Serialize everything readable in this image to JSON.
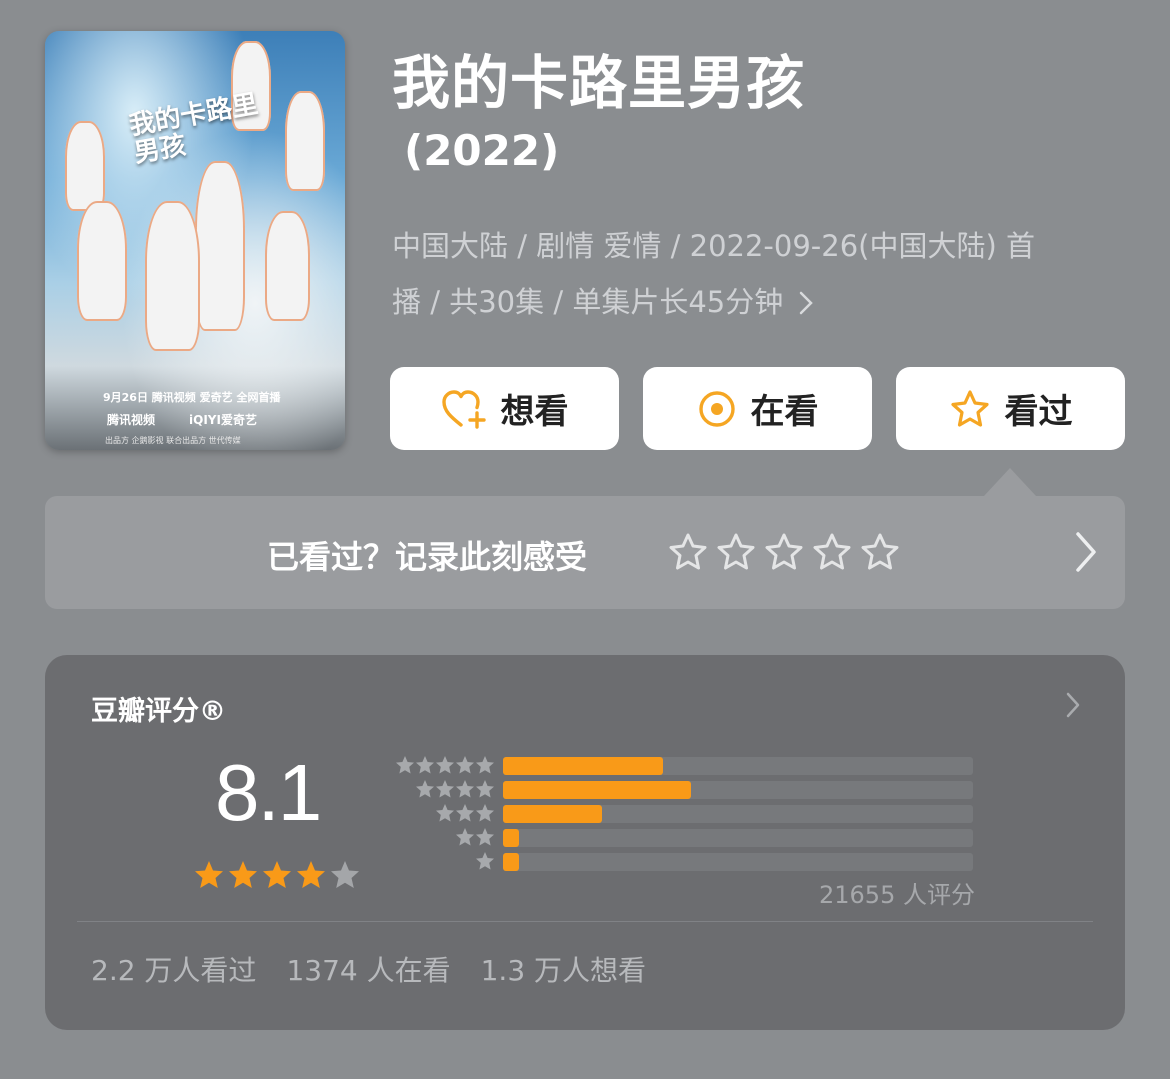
{
  "poster": {
    "title_art": "我的卡路里男孩",
    "release_line": "9月26日 腾讯视频 爱奇艺 全网首播",
    "brand_tencent": "腾讯视频",
    "brand_iqiyi": "iQIYI爱奇艺",
    "producers_line": "出品方  企鹅影视    联合出品方  世代传媒"
  },
  "title": "我的卡路里男孩",
  "year": "(2022)",
  "meta": {
    "line1": "中国大陆 / 剧情 爱情 / 2022-09-26(中国大陆) 首",
    "line2": "播 / 共30集 / 单集片长45分钟"
  },
  "actions": {
    "want": "想看",
    "watching": "在看",
    "watched": "看过"
  },
  "rate_prompt": "已看过？记录此刻感受",
  "rating": {
    "label": "豆瓣评分®",
    "score": "8.1",
    "stars_filled": 4,
    "distribution": [
      {
        "stars": 5,
        "fraction": 0.34
      },
      {
        "stars": 4,
        "fraction": 0.4
      },
      {
        "stars": 3,
        "fraction": 0.21
      },
      {
        "stars": 2,
        "fraction": 0.035
      },
      {
        "stars": 1,
        "fraction": 0.035
      }
    ],
    "count_text": "21655 人评分",
    "watched_text": "2.2 万人看过",
    "watching_text": "1374 人在看",
    "want_text": "1.3 万人想看"
  },
  "colors": {
    "accent": "#f99a18",
    "background": "#8a8d90",
    "card": "#6c6d70"
  }
}
